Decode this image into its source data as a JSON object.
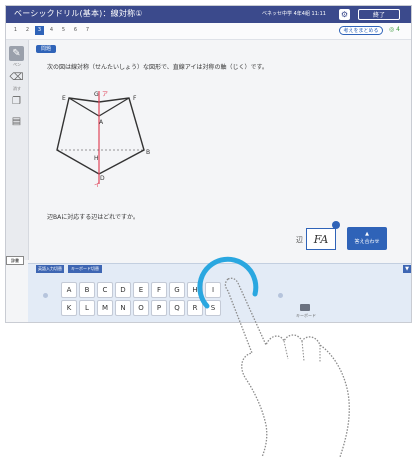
{
  "header": {
    "title": "ベーシックドリル(基本)：線対称①",
    "info": "ベネッセ中学 4年4組 11:11",
    "end_label": "終了"
  },
  "tabs": [
    "1",
    "2",
    "3",
    "4",
    "5",
    "6",
    "7"
  ],
  "active_tab": 2,
  "hint_label": "考えをまとめる",
  "status_text": "◎ 4",
  "sidebar": {
    "labels": [
      "ペン",
      "消す"
    ]
  },
  "question": {
    "tag": "問題",
    "text": "次の図は線対称（せんたいしょう）な図形で、直線アイは対称の軸（じく）です。",
    "prompt": "辺BAに対応する辺はどれですか。",
    "figure_labels": {
      "G": "G",
      "ア": "ア",
      "E": "E",
      "F": "F",
      "A": "A",
      "C": "C",
      "B": "B",
      "H": "H",
      "D": "D",
      "イ": "イ"
    }
  },
  "answer": {
    "prefix": "辺",
    "value": "FA",
    "submit_label": "答え合わせ"
  },
  "dictionary_label": "辞書",
  "keyboard": {
    "tabs": [
      "英語入力切替",
      "キーボード切替"
    ],
    "corner_label": "▼",
    "row1": [
      "A",
      "B",
      "C",
      "D",
      "E",
      "F",
      "G",
      "H",
      "I"
    ],
    "row2": [
      "K",
      "L",
      "M",
      "N",
      "O",
      "P",
      "Q",
      "R",
      "S"
    ],
    "icon_label": "キーボード"
  },
  "colors": {
    "titlebar": "#3b4a8c",
    "accent": "#2f63b8",
    "axis": "#e0445a",
    "ring": "#2aa7e0"
  }
}
